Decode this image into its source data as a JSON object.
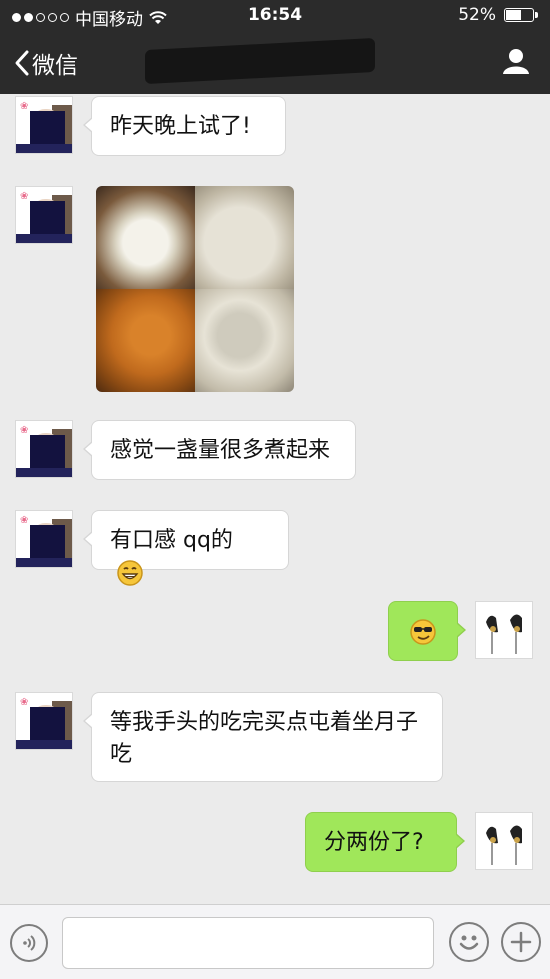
{
  "status": {
    "carrier": "中国移动",
    "time": "16:54",
    "battery": "52%",
    "battery_level": 0.52
  },
  "nav": {
    "back_label": "微信"
  },
  "messages": [
    {
      "side": "in",
      "text": "昨天晚上试了!"
    },
    {
      "side": "in",
      "type": "image"
    },
    {
      "side": "in",
      "text": "感觉一盏量很多煮起来"
    },
    {
      "side": "in",
      "text": "有口感 qq的",
      "emoji": "grin-emoji"
    },
    {
      "side": "out",
      "emoji": "sunglasses-emoji"
    },
    {
      "side": "in",
      "text": "等我手头的吃完买点屯着坐月子吃"
    },
    {
      "side": "out",
      "text": "分两份了?"
    }
  ],
  "colors": {
    "nav_bg": "#2b2b2b",
    "chat_bg": "#ebebeb",
    "outgoing_bubble": "#a0e75a",
    "incoming_bubble": "#ffffff"
  },
  "icons": {
    "back": "chevron-left-icon",
    "user": "user-icon",
    "voice": "voice-icon",
    "emoji": "smiley-icon",
    "add": "plus-icon"
  }
}
